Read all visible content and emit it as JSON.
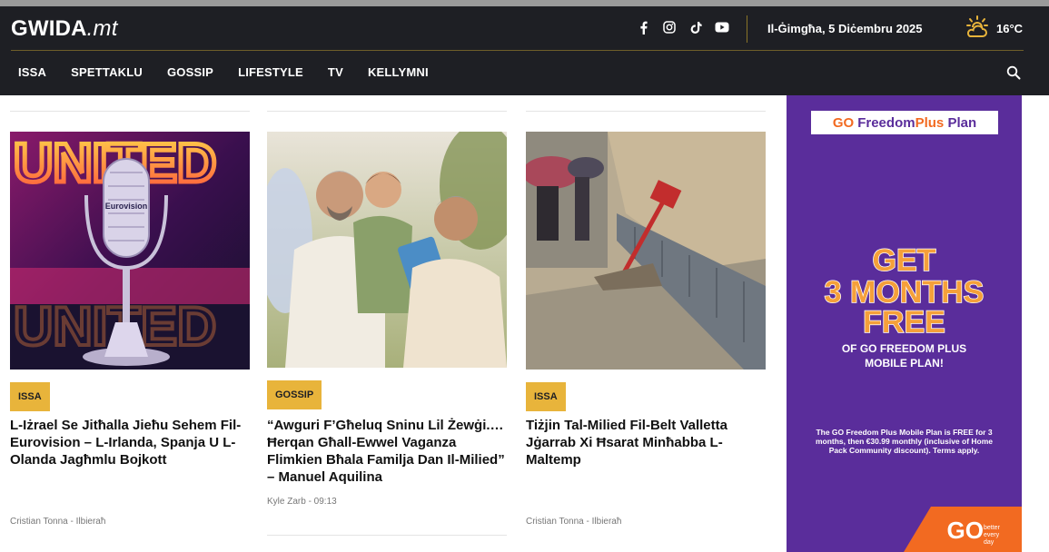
{
  "header": {
    "logo_brand": "GWIDA",
    "logo_tld": ".mt",
    "date": "Il-Ġimgħa, 5 Diċembru 2025",
    "temperature": "16°C",
    "weather_icon": "partly-cloudy-sun-icon",
    "socials": [
      "facebook-icon",
      "instagram-icon",
      "tiktok-icon",
      "youtube-icon"
    ],
    "nav": [
      "ISSA",
      "SPETTAKLU",
      "GOSSIP",
      "LIFESTYLE",
      "TV",
      "KELLYMNI"
    ]
  },
  "articles": [
    {
      "category": "ISSA",
      "title": "L-Iżrael Se Jitħalla Jieħu Sehem Fil-Eurovision – L-Irlanda, Spanja U L-Olanda Jagħmlu Bojkott",
      "byline": "Cristian Tonna - Ilbieraħ",
      "image_text": "UNITED",
      "trophy_label": "Eurovision"
    },
    {
      "category": "GOSSIP",
      "title": "“Awguri F’Għeluq Sninu Lil Żewġi.… Ħerqan Għall-Ewwel Vaganza Flimkien Bħala Familja Dan Il-Milied” – Manuel Aquilina",
      "byline": "Kyle Zarb - 09:13"
    },
    {
      "category": "ISSA",
      "title": "Tiżjin Tal-Milied Fil-Belt Valletta Jġarrab Xi Ħsarat Minħabba L-Maltemp",
      "byline": "Cristian Tonna - Ilbieraħ"
    }
  ],
  "ad": {
    "top_go": "GO",
    "top_freedom": "Freedom",
    "top_plus": "Plus",
    "top_plan": "Plan",
    "headline_1": "GET",
    "headline_2": "3 MONTHS",
    "headline_3": "FREE",
    "sub_1": "OF GO FREEDOM PLUS",
    "sub_2": "MOBILE PLAN!",
    "fine_print": "The GO Freedom Plus Mobile Plan is FREE for 3 months, then €30.99 monthly (inclusive of Home Pack Community discount). Terms apply.",
    "corner_logo": "GO",
    "tagline_1": "better",
    "tagline_2": "every",
    "tagline_3": "day"
  },
  "colors": {
    "header_bg": "#1e1f24",
    "badge": "#e8b43b",
    "ad_purple": "#5a2d9b",
    "ad_orange": "#f26a21"
  }
}
